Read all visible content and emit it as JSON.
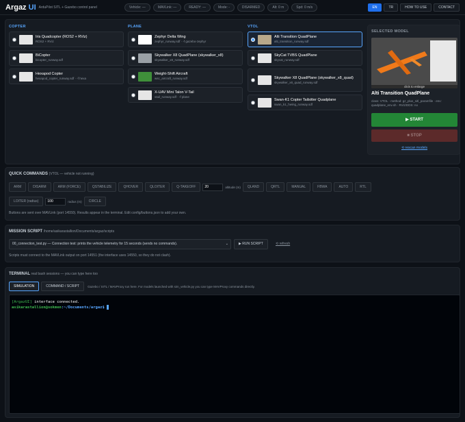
{
  "header": {
    "brand_a": "Argaz",
    "brand_b": "UI",
    "tagline": "ArduPilot SITL + Gazebo control panel",
    "pills": [
      "Vehicle: —",
      "MAVLink: —",
      "READY: —",
      "Mode: -",
      "DISARMED",
      "Alt: 0 m",
      "Spd: 0 m/s"
    ],
    "lang": [
      "EN",
      "TR"
    ],
    "how_to_use": "HOW TO USE",
    "contact": "CONTACT"
  },
  "models": {
    "copter": {
      "title": "COPTER",
      "items": [
        {
          "name": "Iris Quadcopter (ROS2 + RViz)",
          "file": "ROS2 + RViz"
        },
        {
          "name": "BiCopter",
          "file": "bicopter_runway.sdf"
        },
        {
          "name": "Hexapod Copter",
          "file": "hexapod_copter_runway.sdf · -f hexa"
        }
      ]
    },
    "plane": {
      "title": "PLANE",
      "items": [
        {
          "name": "Zephyr Delta Wing",
          "file": "zephyr_runway.sdf · -f gazebo-zephyr"
        },
        {
          "name": "Skywalker X8 QuadPlane (skywalker_x8)",
          "file": "skywalker_x8_runway.sdf"
        },
        {
          "name": "Weight-Shift Aircraft",
          "file": "wsc_aircraft_runway.sdf"
        },
        {
          "name": "X-UAV Mini Talon V-Tail",
          "file": "vtail_runway.sdf · -f plane"
        }
      ]
    },
    "vtol": {
      "title": "VTOL",
      "items": [
        {
          "name": "Alti Transition QuadPlane",
          "file": "alti_transition_runway.sdf"
        },
        {
          "name": "SkyCat TVBS QuadPlane",
          "file": "skycat_runway.sdf"
        },
        {
          "name": "Skywalker X8 QuadPlane (skywalker_x8_quad)",
          "file": "skywalker_x8_quad_runway.sdf"
        },
        {
          "name": "Swan-K1 Copter Tailsitter Quadplane",
          "file": "swan_k1_hwing_runway.sdf"
        }
      ]
    }
  },
  "selected": {
    "title": "SELECTED MODEL",
    "enlarge": "click to enlarge",
    "name": "Alti Transition QuadPlane",
    "meta": "class: VTOL · method: gz_plus_sitl_paramfile · env: quadplane_env.sh · RViz/DDS: no",
    "start": "▶ START",
    "stop": "■ STOP",
    "rescan": "⟲ rescan models"
  },
  "quick": {
    "title": "QUICK COMMANDS",
    "sub": "(VTOL — vehicle not running)",
    "row1": [
      "ARM",
      "DISARM",
      "ARM (FORCE)",
      "QSTABILIZE",
      "QHOVER",
      "QLOITER",
      "Q-TAKEOFF"
    ],
    "takeoff_val": "20",
    "takeoff_lbl": "altitude (m)",
    "row1b": [
      "QLAND",
      "QRTL",
      "MANUAL",
      "FBWA",
      "AUTO",
      "RTL"
    ],
    "loiter": "LOITER (radius)",
    "loiter_val": "100",
    "loiter_lbl": "radius (m)",
    "circle": "CIRCLE",
    "note": "Buttons are sent over MAVLink (port 14550). Results appear in the terminal. Edit config/buttons.json to add your own."
  },
  "mission": {
    "title": "MISSION SCRIPT",
    "path": "/home/asikarastallion/Documents/argaz/scripts",
    "selected": "00_connection_test.py — Connection test: prints the vehicle telemetry for 15 seconds (sends no commands).",
    "run": "▶ RUN SCRIPT",
    "refresh": "⟲ refresh",
    "note": "Scripts must connect to the MAVLink output on port 14551 (the interface uses 14550, so they do not clash)."
  },
  "terminal": {
    "title": "TERMINAL",
    "sub": "real bash sessions — you can type here too",
    "tabs": [
      "SIMULATION",
      "COMMAND / SCRIPT"
    ],
    "hint": "Gazebo / SITL / MAVProxy run here. For models launched with sim_vehicle.py you can type MAVProxy commands directly.",
    "line1_tag": "[ArgazUI]",
    "line1": " interface connected.",
    "prompt_user": "asikarastallion@sokmen",
    "prompt_path": ":~/Documents/argaz$"
  },
  "colors": {
    "accent": "#58a6ff",
    "start": "#238636",
    "stop": "#5c2a2a"
  }
}
